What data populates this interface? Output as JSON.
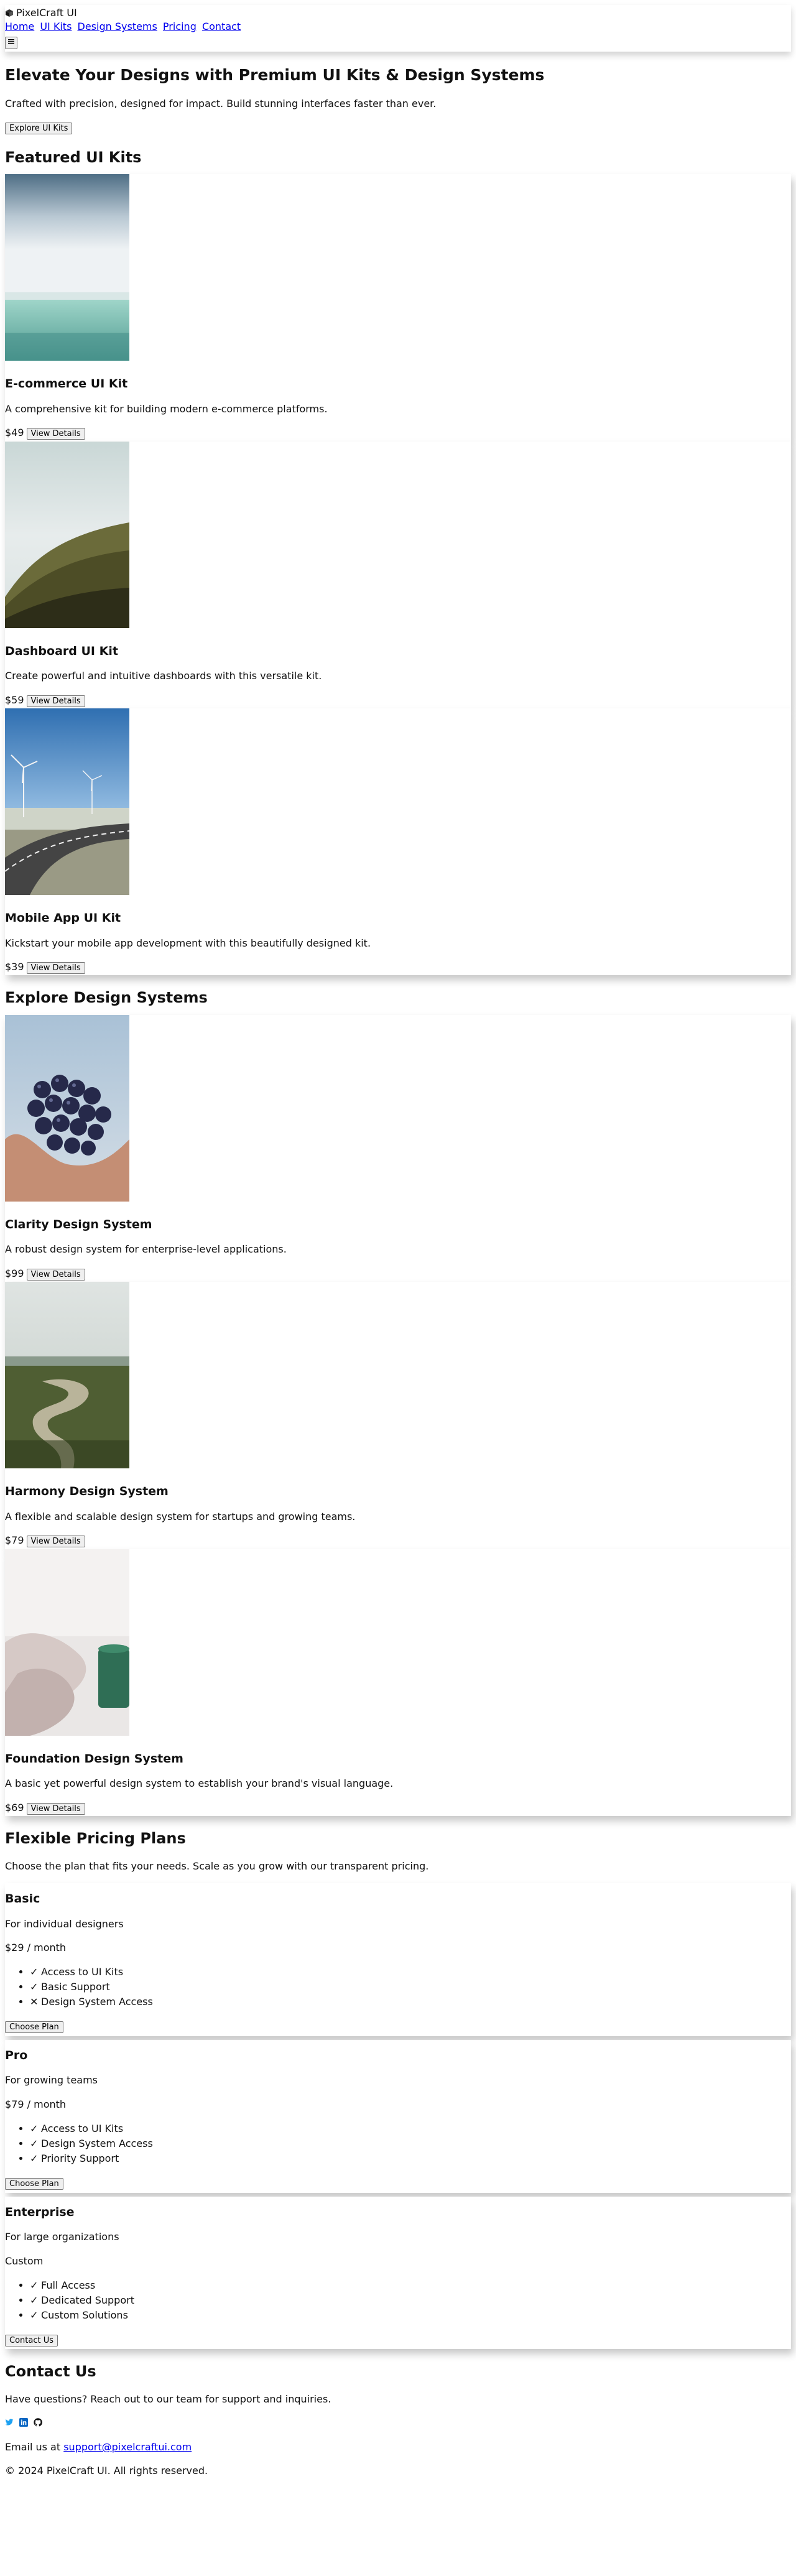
{
  "header": {
    "brand": "PixelCraft UI",
    "nav": [
      "Home",
      "UI Kits",
      "Design Systems",
      "Pricing",
      "Contact"
    ],
    "menu_icon": "hamburger-icon"
  },
  "hero": {
    "title": "Elevate Your Designs with Premium UI Kits & Design Systems",
    "subtitle": "Crafted with precision, designed for impact. Build stunning interfaces faster than ever.",
    "cta": "Explore UI Kits"
  },
  "ui_kits": {
    "heading": "Featured UI Kits",
    "items": [
      {
        "title": "E-commerce UI Kit",
        "desc": "A comprehensive kit for building modern e-commerce platforms.",
        "price": "$49",
        "button": "View Details",
        "image": "sea-horizon"
      },
      {
        "title": "Dashboard UI Kit",
        "desc": "Create powerful and intuitive dashboards with this versatile kit.",
        "price": "$59",
        "button": "View Details",
        "image": "green-hillside"
      },
      {
        "title": "Mobile App UI Kit",
        "desc": "Kickstart your mobile app development with this beautifully designed kit.",
        "price": "$39",
        "button": "View Details",
        "image": "road-wind-turbines"
      }
    ]
  },
  "design_systems": {
    "heading": "Explore Design Systems",
    "items": [
      {
        "title": "Clarity Design System",
        "desc": "A robust design system for enterprise-level applications.",
        "price": "$99",
        "button": "View Details",
        "image": "hands-with-grapes"
      },
      {
        "title": "Harmony Design System",
        "desc": "A flexible and scalable design system for startups and growing teams.",
        "price": "$79",
        "button": "View Details",
        "image": "river-forest"
      },
      {
        "title": "Foundation Design System",
        "desc": "A basic yet powerful design system to establish your brand's visual language.",
        "price": "$69",
        "button": "View Details",
        "image": "cozy-mug"
      }
    ]
  },
  "pricing": {
    "heading": "Flexible Pricing Plans",
    "intro": "Choose the plan that fits your needs. Scale as you grow with our transparent pricing.",
    "plans": [
      {
        "name": "Basic",
        "audience": "For individual designers",
        "price": "$29 / month",
        "features": [
          {
            "text": "Access to UI Kits",
            "included": true
          },
          {
            "text": "Basic Support",
            "included": true
          },
          {
            "text": "Design System Access",
            "included": false
          }
        ],
        "button": "Choose Plan"
      },
      {
        "name": "Pro",
        "audience": "For growing teams",
        "price": "$79 / month",
        "features": [
          {
            "text": "Access to UI Kits",
            "included": true
          },
          {
            "text": "Design System Access",
            "included": true
          },
          {
            "text": "Priority Support",
            "included": true
          }
        ],
        "button": "Choose Plan"
      },
      {
        "name": "Enterprise",
        "audience": "For large organizations",
        "price": "Custom",
        "features": [
          {
            "text": "Full Access",
            "included": true
          },
          {
            "text": "Dedicated Support",
            "included": true
          },
          {
            "text": "Custom Solutions",
            "included": true
          }
        ],
        "button": "Contact Us"
      }
    ]
  },
  "contact": {
    "heading": "Contact Us",
    "text": "Have questions? Reach out to our team for support and inquiries.",
    "social": [
      "twitter-icon",
      "linkedin-icon",
      "github-icon"
    ],
    "email_prefix": "Email us at",
    "email": "support@pixelcraftui.com",
    "copyright": "© 2024 PixelCraft UI. All rights reserved."
  },
  "colors": {
    "link": "#0000ee",
    "twitter": "#1da1f2",
    "linkedin": "#0a66c2",
    "github": "#111111"
  }
}
